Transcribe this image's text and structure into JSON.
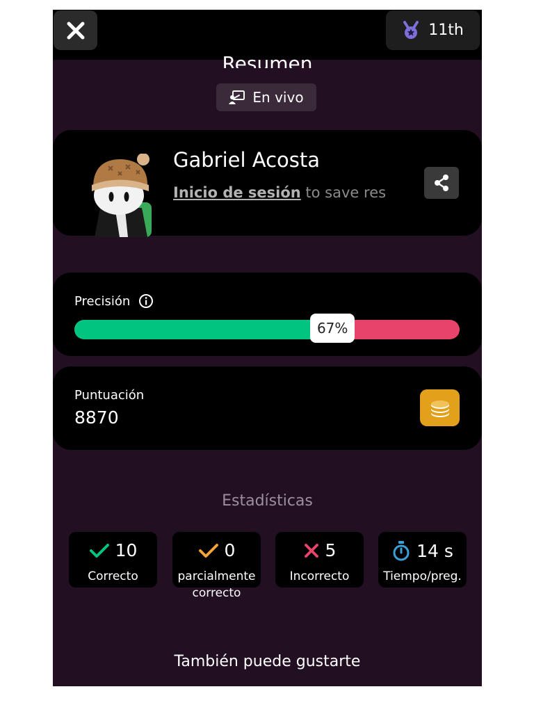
{
  "header": {
    "rank": "11th",
    "title": "Resumen",
    "mode_label": "En vivo"
  },
  "profile": {
    "name": "Gabriel Acosta",
    "login_link": "Inicio de sesión",
    "login_suffix": " to save res"
  },
  "accuracy": {
    "label": "Precisión",
    "percent_text": "67%",
    "percent_value": 67
  },
  "score": {
    "label": "Puntuación",
    "value": "8870"
  },
  "stats": {
    "title": "Estadísticas",
    "items": [
      {
        "value": "10",
        "label": "Correcto",
        "icon": "check-icon",
        "color": "#00c47f"
      },
      {
        "value": "0",
        "label": "parcialmente correcto",
        "icon": "check-icon",
        "color": "#f2a43a"
      },
      {
        "value": "5",
        "label": "Incorrecto",
        "icon": "cross-icon",
        "color": "#e8436a"
      },
      {
        "value": "14 s",
        "label": "Tiempo/preg.",
        "icon": "stopwatch-icon",
        "color": "#3aa0d8"
      }
    ]
  },
  "footer": {
    "also_like": "También puede gustarte"
  },
  "colors": {
    "background": "#220f22",
    "accent_correct": "#00c47f",
    "accent_incorrect": "#e8436a",
    "coin": "#e3a01b"
  }
}
